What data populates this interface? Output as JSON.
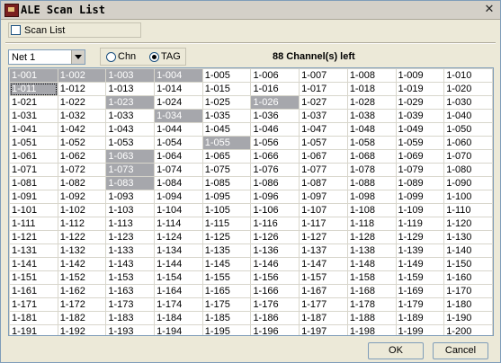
{
  "window": {
    "title": "ALE Scan List"
  },
  "scan_list": {
    "label": "Scan List",
    "checked": false
  },
  "net_select": {
    "value": "Net 1"
  },
  "mode": {
    "chn_label": "Chn",
    "tag_label": "TAG",
    "selected": "TAG"
  },
  "channels_left_text": "88 Channel(s) left",
  "selected_channels": [
    "1-001",
    "1-002",
    "1-003",
    "1-004",
    "1-011",
    "1-023",
    "1-026",
    "1-034",
    "1-055",
    "1-063",
    "1-073",
    "1-083"
  ],
  "focused_channel": "1-011",
  "channel_rows": [
    [
      "1-001",
      "1-002",
      "1-003",
      "1-004",
      "1-005",
      "1-006",
      "1-007",
      "1-008",
      "1-009",
      "1-010"
    ],
    [
      "1-011",
      "1-012",
      "1-013",
      "1-014",
      "1-015",
      "1-016",
      "1-017",
      "1-018",
      "1-019",
      "1-020"
    ],
    [
      "1-021",
      "1-022",
      "1-023",
      "1-024",
      "1-025",
      "1-026",
      "1-027",
      "1-028",
      "1-029",
      "1-030"
    ],
    [
      "1-031",
      "1-032",
      "1-033",
      "1-034",
      "1-035",
      "1-036",
      "1-037",
      "1-038",
      "1-039",
      "1-040"
    ],
    [
      "1-041",
      "1-042",
      "1-043",
      "1-044",
      "1-045",
      "1-046",
      "1-047",
      "1-048",
      "1-049",
      "1-050"
    ],
    [
      "1-051",
      "1-052",
      "1-053",
      "1-054",
      "1-055",
      "1-056",
      "1-057",
      "1-058",
      "1-059",
      "1-060"
    ],
    [
      "1-061",
      "1-062",
      "1-063",
      "1-064",
      "1-065",
      "1-066",
      "1-067",
      "1-068",
      "1-069",
      "1-070"
    ],
    [
      "1-071",
      "1-072",
      "1-073",
      "1-074",
      "1-075",
      "1-076",
      "1-077",
      "1-078",
      "1-079",
      "1-080"
    ],
    [
      "1-081",
      "1-082",
      "1-083",
      "1-084",
      "1-085",
      "1-086",
      "1-087",
      "1-088",
      "1-089",
      "1-090"
    ],
    [
      "1-091",
      "1-092",
      "1-093",
      "1-094",
      "1-095",
      "1-096",
      "1-097",
      "1-098",
      "1-099",
      "1-100"
    ],
    [
      "1-101",
      "1-102",
      "1-103",
      "1-104",
      "1-105",
      "1-106",
      "1-107",
      "1-108",
      "1-109",
      "1-110"
    ],
    [
      "1-111",
      "1-112",
      "1-113",
      "1-114",
      "1-115",
      "1-116",
      "1-117",
      "1-118",
      "1-119",
      "1-120"
    ],
    [
      "1-121",
      "1-122",
      "1-123",
      "1-124",
      "1-125",
      "1-126",
      "1-127",
      "1-128",
      "1-129",
      "1-130"
    ],
    [
      "1-131",
      "1-132",
      "1-133",
      "1-134",
      "1-135",
      "1-136",
      "1-137",
      "1-138",
      "1-139",
      "1-140"
    ],
    [
      "1-141",
      "1-142",
      "1-143",
      "1-144",
      "1-145",
      "1-146",
      "1-147",
      "1-148",
      "1-149",
      "1-150"
    ],
    [
      "1-151",
      "1-152",
      "1-153",
      "1-154",
      "1-155",
      "1-156",
      "1-157",
      "1-158",
      "1-159",
      "1-160"
    ],
    [
      "1-161",
      "1-162",
      "1-163",
      "1-164",
      "1-165",
      "1-166",
      "1-167",
      "1-168",
      "1-169",
      "1-170"
    ],
    [
      "1-171",
      "1-172",
      "1-173",
      "1-174",
      "1-175",
      "1-176",
      "1-177",
      "1-178",
      "1-179",
      "1-180"
    ],
    [
      "1-181",
      "1-182",
      "1-183",
      "1-184",
      "1-185",
      "1-186",
      "1-187",
      "1-188",
      "1-189",
      "1-190"
    ],
    [
      "1-191",
      "1-192",
      "1-193",
      "1-194",
      "1-195",
      "1-196",
      "1-197",
      "1-198",
      "1-199",
      "1-200"
    ]
  ],
  "buttons": {
    "ok": "OK",
    "cancel": "Cancel"
  },
  "icons": {
    "app": "radio-app-icon",
    "close": "close-icon"
  },
  "colors": {
    "selected_cell": "#a6a7ac",
    "grid_line": "#d8d6cc"
  }
}
